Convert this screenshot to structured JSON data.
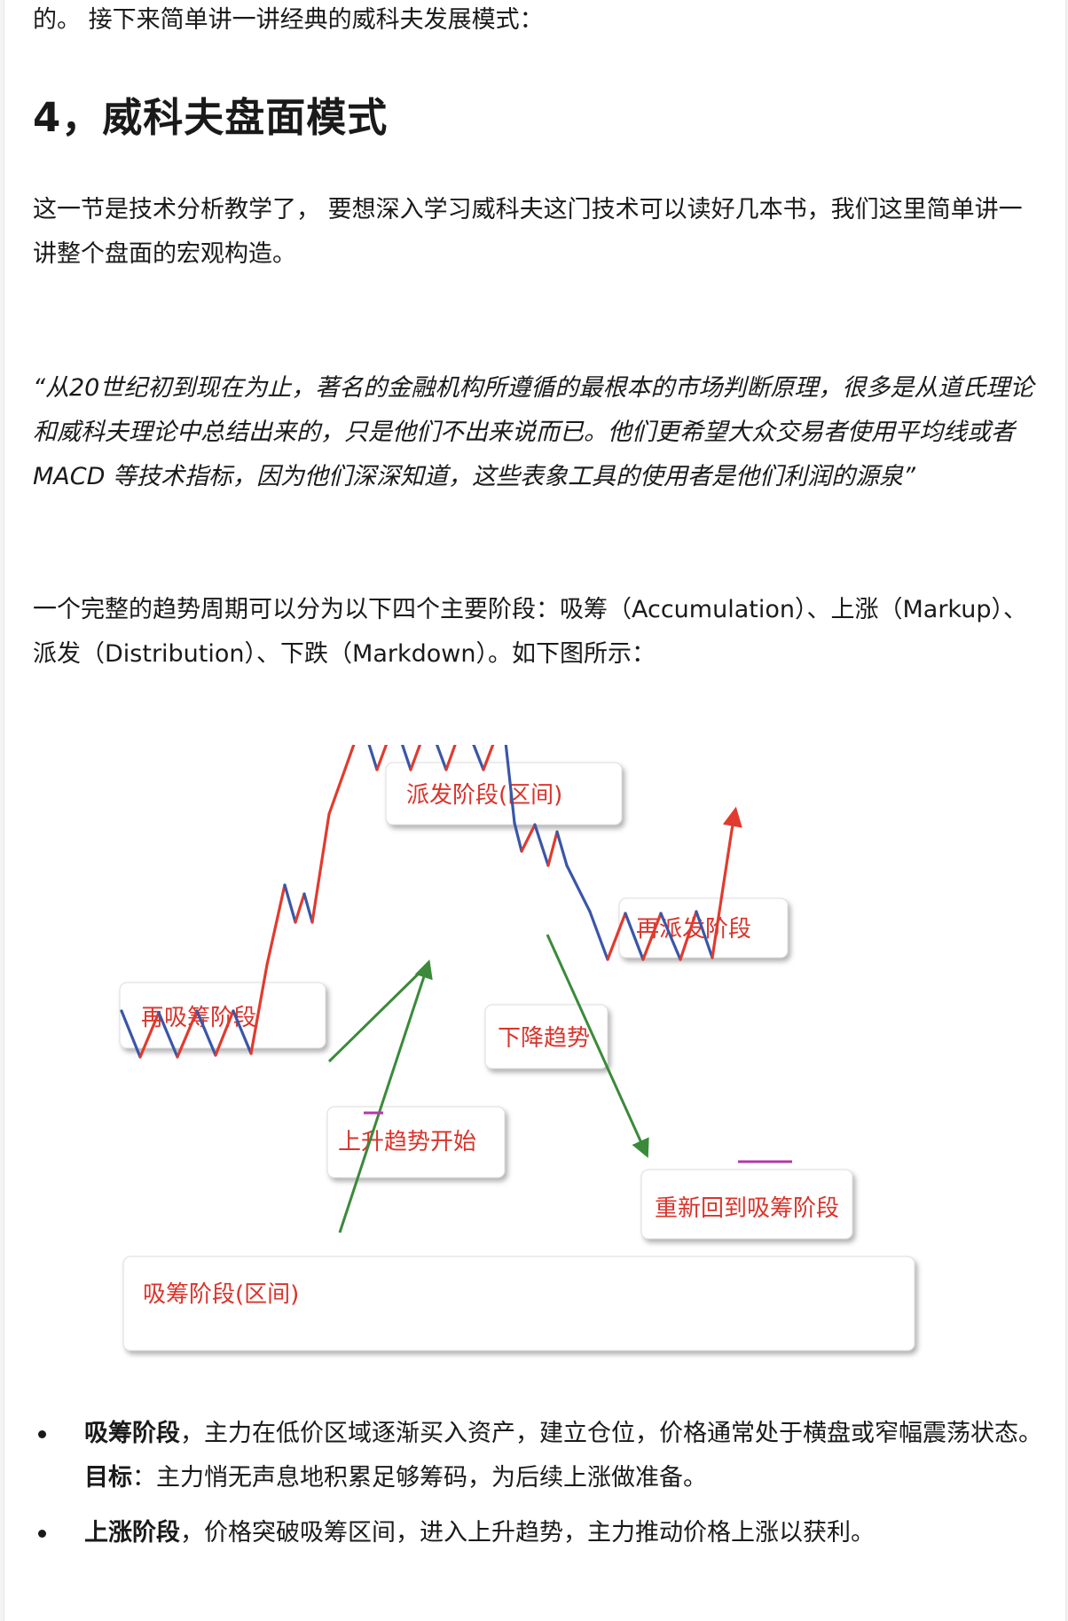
{
  "article": {
    "intro_line": "的。 接下来简单讲一讲经典的威科夫发展模式：",
    "heading": "4，威科夫盘面模式",
    "para1": "这一节是技术分析教学了， 要想深入学习威科夫这门技术可以读好几本书，我们这里简单讲一讲整个盘面的宏观构造。",
    "quote": "“从20世纪初到现在为止，著名的金融机构所遵循的最根本的市场判断原理，很多是从道氏理论和威科夫理论中总结出来的，只是他们不出来说而已。他们更希望大众交易者使用平均线或者 MACD 等技术指标，因为他们深深知道，这些表象工具的使用者是他们利润的源泉”",
    "para2": "一个完整的趋势周期可以分为以下四个主要阶段：吸筹（Accumulation）、上涨（Markup）、派发（Distribution）、下跌（Markdown）。如下图所示："
  },
  "diagram": {
    "labels": {
      "distribution": "派发阶段(区间)",
      "redistribution": "再派发阶段",
      "reaccumulation": "再吸筹阶段",
      "downtrend": "下降趋势",
      "uptrend_start": "上升趋势开始",
      "back_to_accumulation": "重新回到吸筹阶段",
      "accumulation": "吸筹阶段(区间)"
    },
    "colors": {
      "label_text": "#d9342b",
      "up_line": "#e23a2e",
      "down_line": "#3a56a8",
      "arrow": "#3a8a3a",
      "support": "#b23aa5"
    }
  },
  "bullets": [
    {
      "bold": "吸筹阶段",
      "text": "，主力在低价区域逐渐买入资产，建立仓位，价格通常处于横盘或窄幅震荡状态。",
      "sub_bold": "目标",
      "sub_text": "：主力悄无声息地积累足够筹码，为后续上涨做准备。"
    },
    {
      "bold": "上涨阶段",
      "text": "，价格突破吸筹区间，进入上升趋势，主力推动价格上涨以获利。"
    }
  ]
}
